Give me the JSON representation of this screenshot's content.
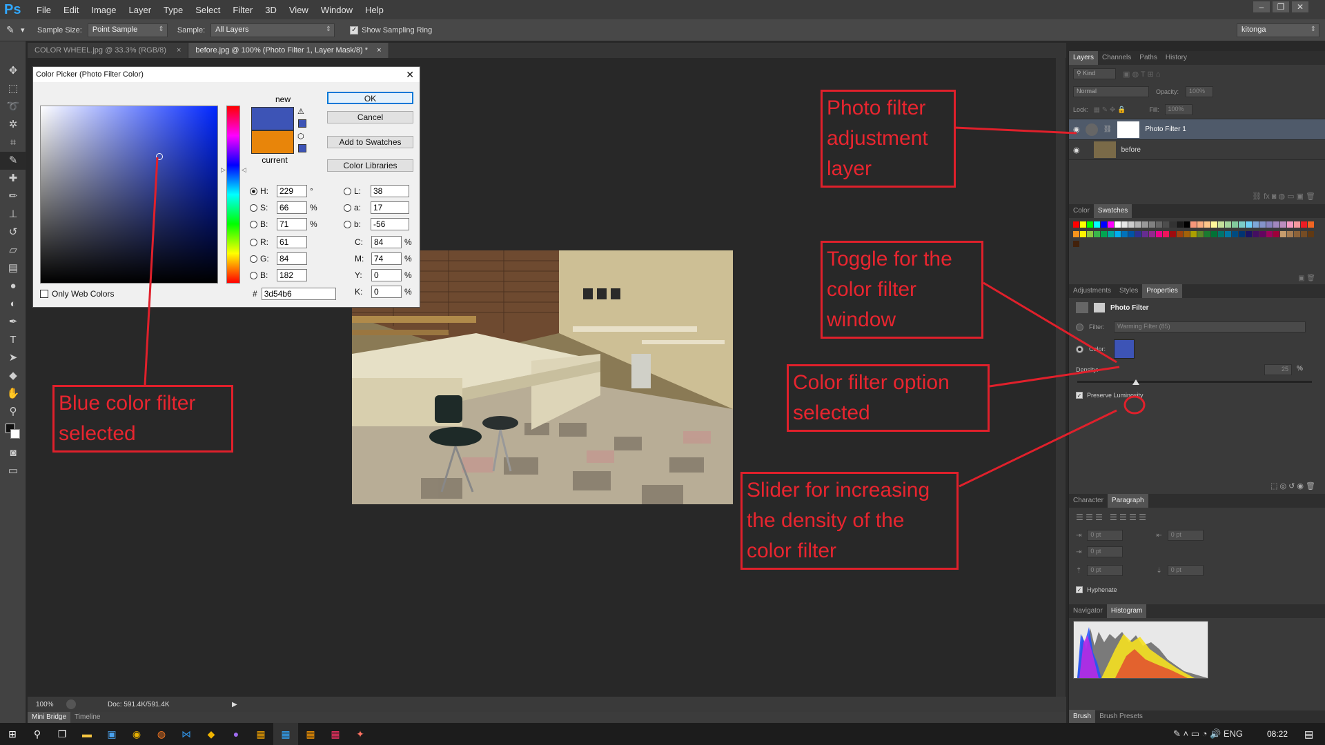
{
  "app": {
    "logo": "Ps",
    "menu": [
      "File",
      "Edit",
      "Image",
      "Layer",
      "Type",
      "Select",
      "Filter",
      "3D",
      "View",
      "Window",
      "Help"
    ]
  },
  "options_bar": {
    "sample_size_label": "Sample Size:",
    "sample_size_value": "Point Sample",
    "sample_label": "Sample:",
    "sample_value": "All Layers",
    "show_ring_label": "Show Sampling Ring",
    "workspace_value": "kitonga"
  },
  "document_tabs": [
    {
      "label": "COLOR WHEEL.jpg @ 33.3% (RGB/8)",
      "close": "×"
    },
    {
      "label": "before.jpg @ 100% (Photo Filter 1, Layer Mask/8) *",
      "close": "×"
    }
  ],
  "status": {
    "zoom": "100%",
    "doc": "Doc: 591.4K/591.4K"
  },
  "bottom_tabs": [
    "Mini Bridge",
    "Timeline"
  ],
  "dialog": {
    "title": "Color Picker (Photo Filter Color)",
    "close": "✕",
    "new_label": "new",
    "current_label": "current",
    "new_color": "#3d54b6",
    "current_color": "#e8850a",
    "buttons": {
      "ok": "OK",
      "cancel": "Cancel",
      "add_swatches": "Add to Swatches",
      "libraries": "Color Libraries"
    },
    "hsb": [
      {
        "label": "H:",
        "value": "229",
        "unit": "°"
      },
      {
        "label": "S:",
        "value": "66",
        "unit": "%"
      },
      {
        "label": "B:",
        "value": "71",
        "unit": "%"
      }
    ],
    "rgb": [
      {
        "label": "R:",
        "value": "61"
      },
      {
        "label": "G:",
        "value": "84"
      },
      {
        "label": "B:",
        "value": "182"
      }
    ],
    "lab": [
      {
        "label": "L:",
        "value": "38"
      },
      {
        "label": "a:",
        "value": "17"
      },
      {
        "label": "b:",
        "value": "-56"
      }
    ],
    "cmyk": [
      {
        "label": "C:",
        "value": "84",
        "unit": "%"
      },
      {
        "label": "M:",
        "value": "74",
        "unit": "%"
      },
      {
        "label": "Y:",
        "value": "0",
        "unit": "%"
      },
      {
        "label": "K:",
        "value": "0",
        "unit": "%"
      }
    ],
    "hex_label": "#",
    "hex_value": "3d54b6",
    "web_colors_label": "Only Web Colors"
  },
  "layers_panel": {
    "tabs": [
      "Layers",
      "Channels",
      "Paths",
      "History"
    ],
    "kind_label": "Kind",
    "blend_mode": "Normal",
    "opacity_label": "Opacity:",
    "opacity_value": "100%",
    "lock_label": "Lock:",
    "fill_label": "Fill:",
    "fill_value": "100%",
    "layers": [
      {
        "name": "Photo Filter 1"
      },
      {
        "name": "before"
      }
    ]
  },
  "swatches_panel": {
    "tabs": [
      "Color",
      "Swatches"
    ]
  },
  "properties_panel": {
    "tabs": [
      "Adjustments",
      "Styles",
      "Properties"
    ],
    "title": "Photo Filter",
    "filter_label": "Filter:",
    "filter_value": "Warming Filter (85)",
    "color_label": "Color:",
    "color_value": "#3d54b6",
    "density_label": "Density:",
    "density_value": "25",
    "density_unit": "%",
    "preserve_label": "Preserve Luminosity"
  },
  "paragraph_panel": {
    "tabs": [
      "Character",
      "Paragraph"
    ],
    "fields": [
      "0 pt",
      "0 pt",
      "0 pt",
      "0 pt",
      "0 pt"
    ],
    "hyphenate_label": "Hyphenate"
  },
  "histogram_panel": {
    "tabs": [
      "Navigator",
      "Histogram"
    ]
  },
  "brush_tabs": [
    "Brush",
    "Brush Presets"
  ],
  "annotations": {
    "blue_filter": "Blue color filter selected",
    "adjustment_layer": "Photo filter adjustment layer",
    "toggle": "Toggle for the color filter window",
    "color_option": "Color filter option selected",
    "slider": "Slider for increasing the density of the color filter"
  },
  "taskbar": {
    "time": "08:22"
  }
}
